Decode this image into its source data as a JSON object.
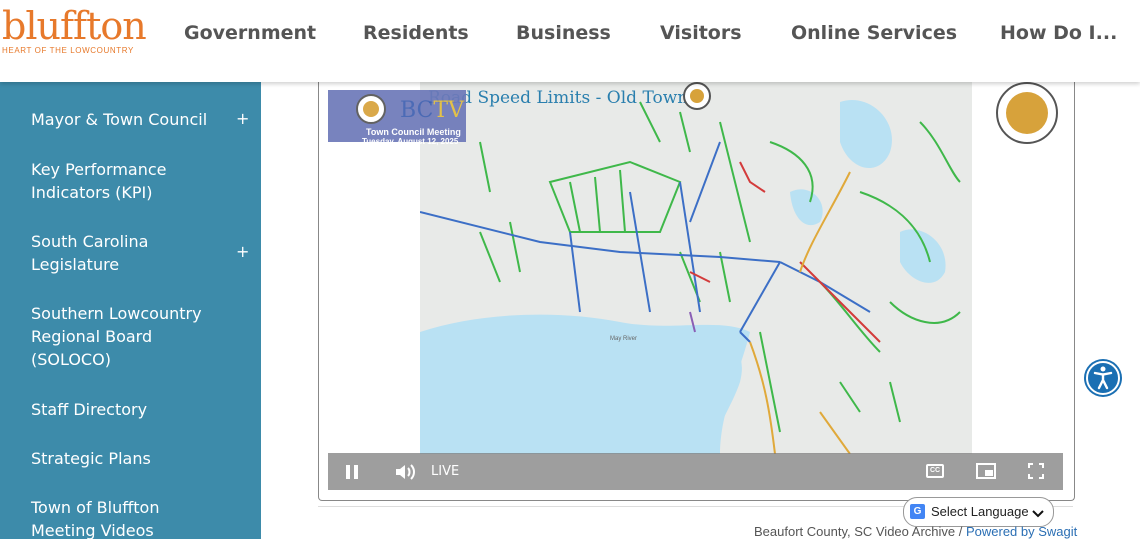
{
  "header": {
    "logo_word": "bluffton",
    "logo_tagline": "HEART OF THE LOWCOUNTRY",
    "nav": [
      "Government",
      "Residents",
      "Business",
      "Visitors",
      "Online Services",
      "How Do I..."
    ]
  },
  "sidebar": {
    "items": [
      {
        "label": "Mayor & Town Council",
        "expandable": true
      },
      {
        "label": "Key Performance Indicators (KPI)",
        "expandable": false
      },
      {
        "label": "South Carolina Legislature",
        "expandable": true
      },
      {
        "label": "Southern Lowcountry Regional Board (SOLOCO)",
        "expandable": false
      },
      {
        "label": "Staff Directory",
        "expandable": false
      },
      {
        "label": "Strategic Plans",
        "expandable": false
      },
      {
        "label": "Town of Bluffton Meeting Videos",
        "expandable": false
      }
    ],
    "plus_symbol": "+"
  },
  "video": {
    "map_title": "Road Speed Limits - Old Town",
    "station_letters_1": "BC",
    "station_letters_2": "TV",
    "meeting_title": "Town Council Meeting",
    "meeting_date": "Tuesday, August 12, 2025",
    "live_label": "LIVE",
    "cc_label": "CC",
    "river_label": "May River"
  },
  "language": {
    "label": "Select Language"
  },
  "credit": {
    "archive": "Beaufort County, SC Video Archive / ",
    "powered": "Powered by Swagit"
  },
  "colors": {
    "brand_orange": "#e7792b",
    "sidebar_blue": "#3d8baa",
    "accessibility_blue": "#1a6fb3"
  },
  "icons": [
    "pause-icon",
    "volume-icon",
    "closed-captions-icon",
    "picture-in-picture-icon",
    "fullscreen-icon",
    "accessibility-icon",
    "google-translate-icon",
    "chevron-down-icon"
  ]
}
